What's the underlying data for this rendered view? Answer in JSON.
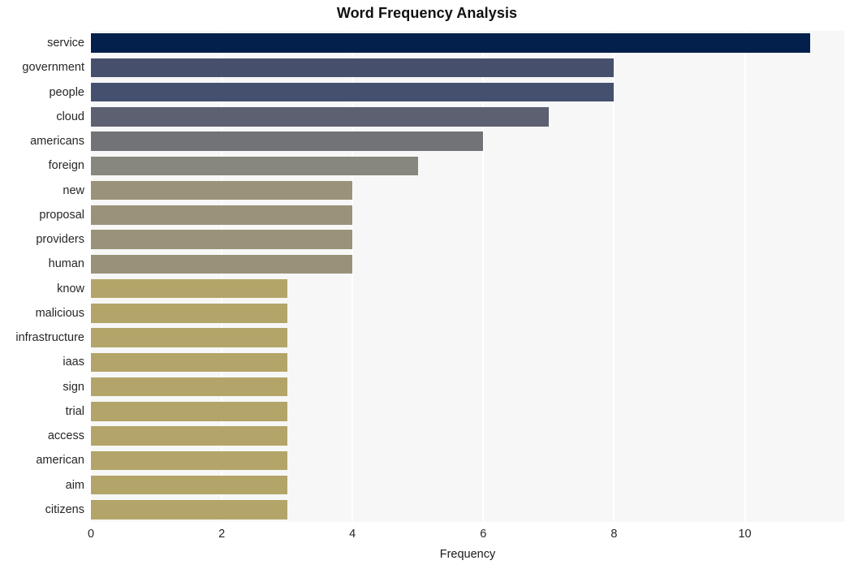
{
  "chart_data": {
    "type": "bar",
    "orientation": "horizontal",
    "title": "Word Frequency Analysis",
    "xlabel": "Frequency",
    "ylabel": "",
    "xlim": [
      0,
      11.52
    ],
    "ylim": [
      0,
      20
    ],
    "grid": "vertical-only",
    "legend": "none",
    "xticks": [
      "0",
      "2",
      "4",
      "6",
      "8",
      "10"
    ],
    "xtick_values": [
      0,
      2,
      4,
      6,
      8,
      10
    ],
    "categories": [
      "service",
      "government",
      "people",
      "cloud",
      "americans",
      "foreign",
      "new",
      "proposal",
      "providers",
      "human",
      "know",
      "malicious",
      "infrastructure",
      "iaas",
      "sign",
      "trial",
      "access",
      "american",
      "aim",
      "citizens"
    ],
    "values": [
      11,
      8,
      8,
      7,
      6,
      5,
      4,
      4,
      4,
      4,
      3,
      3,
      3,
      3,
      3,
      3,
      3,
      3,
      3,
      3
    ],
    "bar_colors": [
      "#03204c",
      "#46506c",
      "#45506f",
      "#5c6070",
      "#717376",
      "#87877e",
      "#9a9379",
      "#9a9379",
      "#9a9379",
      "#9a9278",
      "#b3a569",
      "#b3a569",
      "#b3a569",
      "#b3a569",
      "#b3a569",
      "#b3a569",
      "#b3a569",
      "#b3a569",
      "#b3a569",
      "#b3a569"
    ]
  },
  "style": {
    "plot_background": "#f7f7f7",
    "page_background": "#ffffff",
    "gridline_color": "#ffffff",
    "text_color": "#262626",
    "title_color": "#101010"
  }
}
